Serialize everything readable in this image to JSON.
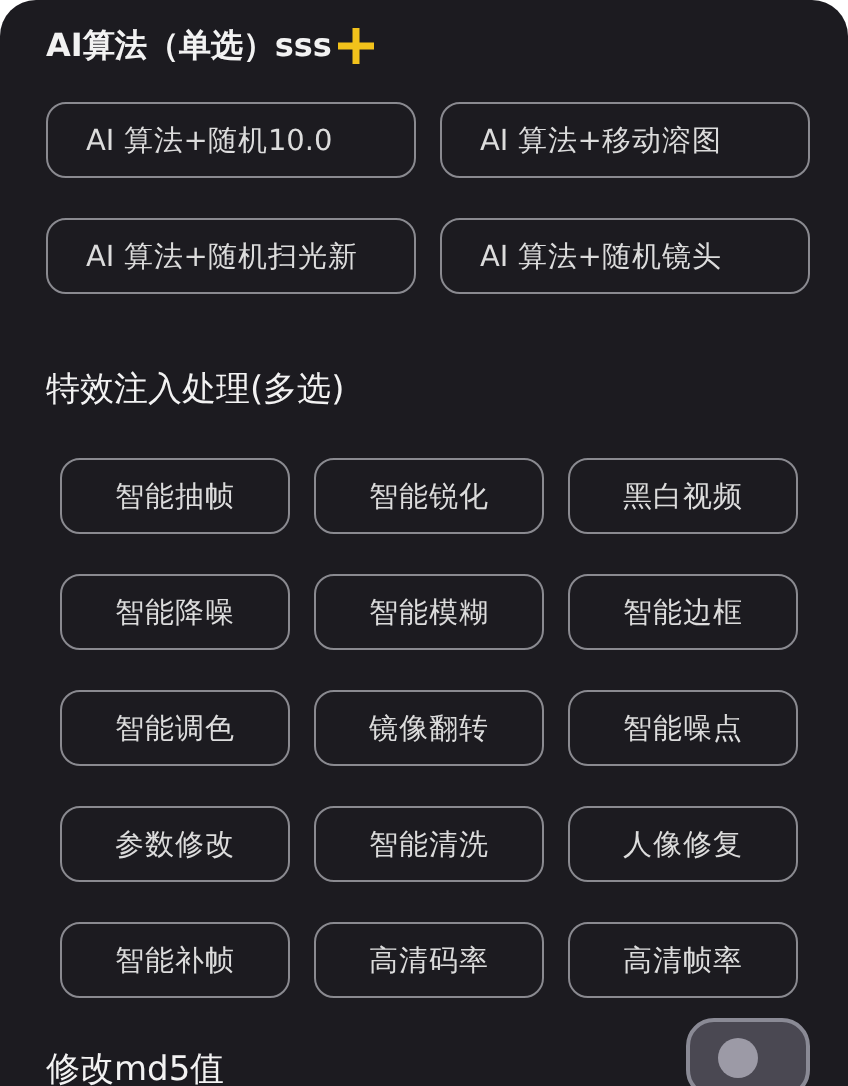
{
  "algorithm_section": {
    "title": "AI算法（单选）sss",
    "options": [
      {
        "label": "AI 算法+随机10.0"
      },
      {
        "label": "AI 算法+移动溶图"
      },
      {
        "label": "AI 算法+随机扫光新"
      },
      {
        "label": "AI 算法+随机镜头"
      }
    ]
  },
  "effects_section": {
    "title": "特效注入处理(多选)",
    "options": [
      {
        "label": "智能抽帧"
      },
      {
        "label": "智能锐化"
      },
      {
        "label": "黑白视频"
      },
      {
        "label": "智能降噪"
      },
      {
        "label": "智能模糊"
      },
      {
        "label": "智能边框"
      },
      {
        "label": "智能调色"
      },
      {
        "label": "镜像翻转"
      },
      {
        "label": "智能噪点"
      },
      {
        "label": "参数修改"
      },
      {
        "label": "智能清洗"
      },
      {
        "label": "人像修复"
      },
      {
        "label": "智能补帧"
      },
      {
        "label": "高清码率"
      },
      {
        "label": "高清帧率"
      }
    ]
  },
  "md5_setting": {
    "label": "修改md5值",
    "on": false
  }
}
